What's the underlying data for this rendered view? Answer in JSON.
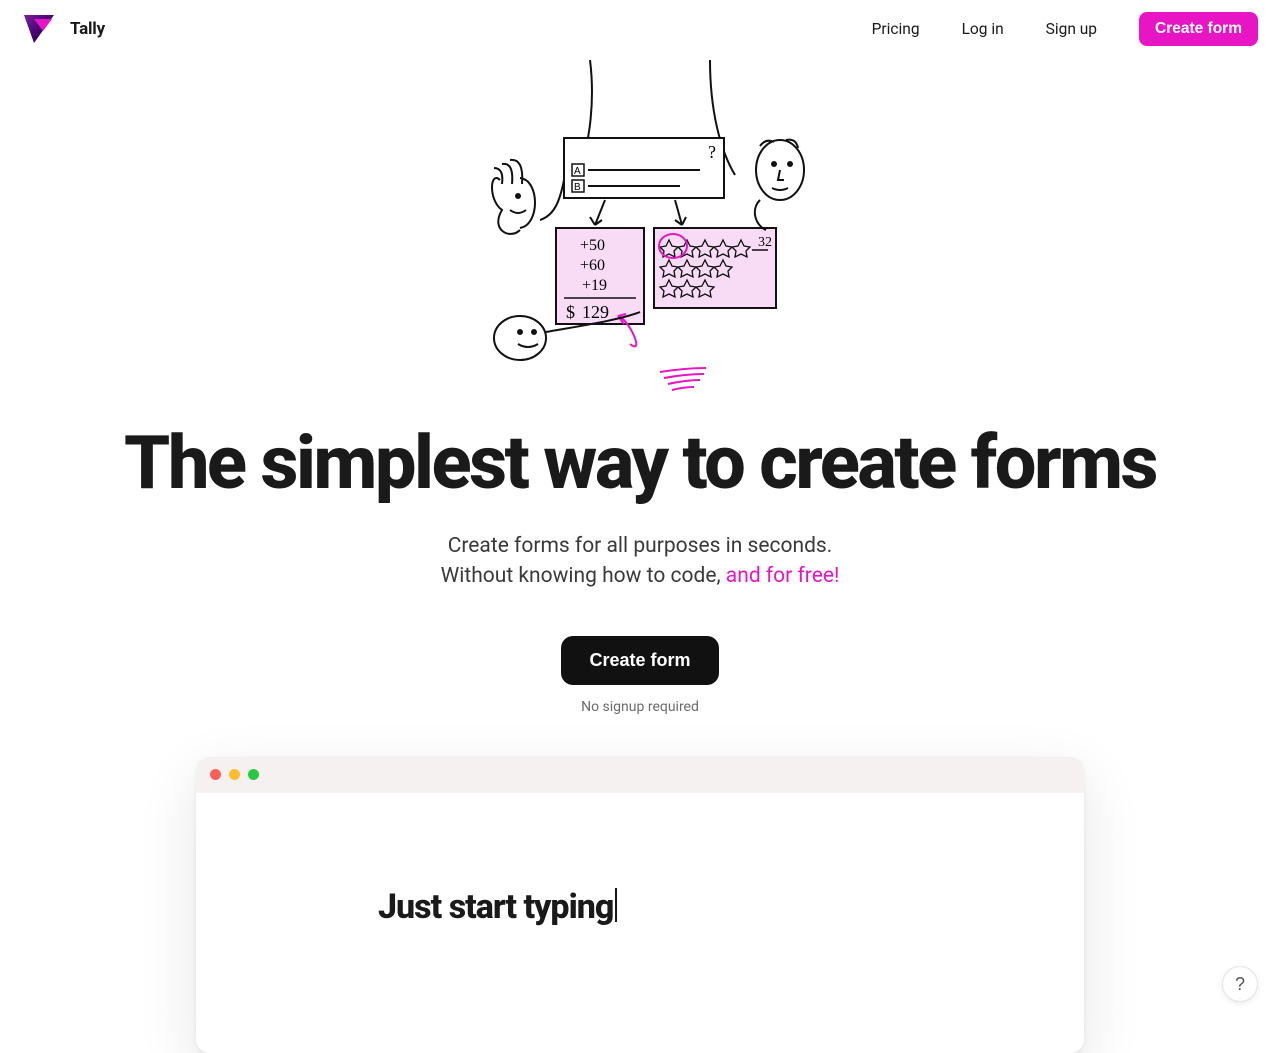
{
  "header": {
    "brand_name": "Tally",
    "nav": {
      "pricing": "Pricing",
      "login": "Log in",
      "signup": "Sign up",
      "create_form": "Create form"
    }
  },
  "hero": {
    "headline": "The simplest way to create forms",
    "sub_line1": "Create forms for all purposes in seconds.",
    "sub_line2_prefix": "Without knowing how to code, ",
    "sub_line2_highlight": "and for free!",
    "cta": "Create form",
    "note": "No signup required"
  },
  "mockup": {
    "typing_text": "Just start typing"
  },
  "help": {
    "label": "?"
  },
  "colors": {
    "accent_pink": "#e815c5",
    "text": "#1a1a1a",
    "button_dark": "#111111"
  },
  "illustration": {
    "question_mark": "?",
    "option_a": "A",
    "option_b": "B",
    "calc_lines": [
      "+50",
      "+60",
      "+19"
    ],
    "calc_total_prefix": "$",
    "calc_total": "129",
    "rating_score": "32"
  }
}
